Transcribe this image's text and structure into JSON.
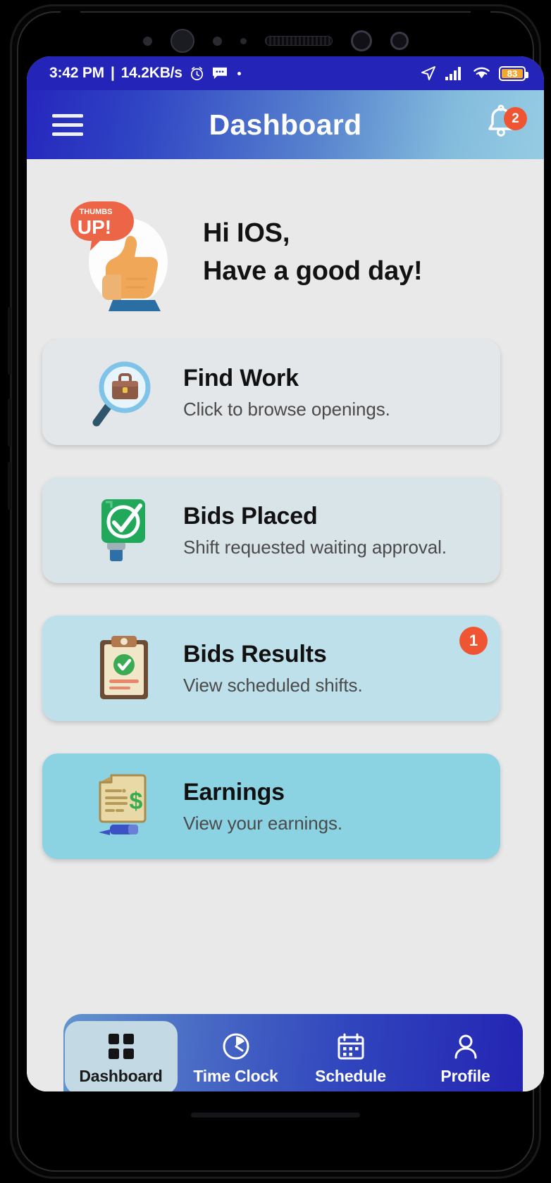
{
  "status_bar": {
    "time": "3:42 PM",
    "separator": "|",
    "network_speed": "14.2KB/s",
    "alarm_icon": "alarm-clock-icon",
    "message_icon": "message-icon",
    "location_icon": "location-arrow-icon",
    "signal_icon": "cellular-signal-icon",
    "wifi_icon": "wifi-icon",
    "battery_level": "83",
    "battery_color": "#f0a830",
    "background_color": "#2424b8"
  },
  "app_bar": {
    "menu_icon": "hamburger-menu-icon",
    "title": "Dashboard",
    "notification_icon": "bell-icon",
    "notification_count": "2",
    "badge_color": "#ef5533",
    "gradient_from": "#2626bd",
    "gradient_to": "#96cce3"
  },
  "greeting": {
    "illustration": "thumbs-up-illustration",
    "bubble_line1": "THUMBS",
    "bubble_line2": "UP!",
    "line1": "Hi IOS,",
    "line2": "Have a good day!"
  },
  "cards": [
    {
      "id": "find-work",
      "title": "Find Work",
      "subtitle": "Click to browse openings.",
      "icon": "magnifier-briefcase-icon",
      "background": "#e4e7e9",
      "badge": null
    },
    {
      "id": "bids-placed",
      "title": "Bids Placed",
      "subtitle": "Shift requested waiting approval.",
      "icon": "green-check-stamp-icon",
      "background": "#d9e4e8",
      "badge": null
    },
    {
      "id": "bids-results",
      "title": "Bids Results",
      "subtitle": "View scheduled shifts.",
      "icon": "clipboard-check-icon",
      "background": "#bee0ea",
      "badge": "1"
    },
    {
      "id": "earnings",
      "title": "Earnings",
      "subtitle": "View your earnings.",
      "icon": "cheque-dollar-pen-icon",
      "background": "#8bd3e2",
      "badge": null
    }
  ],
  "bottom_nav": {
    "gradient_from": "#6394cd",
    "gradient_to": "#2424b3",
    "active_pill_color": "#c3dae4",
    "items": [
      {
        "id": "dashboard",
        "label": "Dashboard",
        "icon": "grid-squares-icon",
        "active": true
      },
      {
        "id": "time-clock",
        "label": "Time Clock",
        "icon": "clock-icon",
        "active": false
      },
      {
        "id": "schedule",
        "label": "Schedule",
        "icon": "calendar-icon",
        "active": false
      },
      {
        "id": "profile",
        "label": "Profile",
        "icon": "person-icon",
        "active": false
      }
    ]
  }
}
